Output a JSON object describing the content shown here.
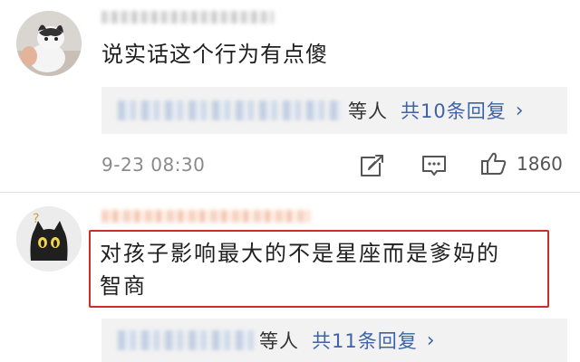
{
  "comments": [
    {
      "text": "说实话这个行为有点傻",
      "replies": {
        "others_label": "等人",
        "count_label": "共10条回复",
        "chevron": "›"
      },
      "time": "9-23 08:30",
      "likes": "1860",
      "avatar_icon": "cat-photo-avatar",
      "action_icons": [
        "share-icon",
        "comment-icon",
        "thumbs-up-icon"
      ]
    },
    {
      "text_line1": "对孩子影响最大的不是星座而是爹妈的",
      "text_line2": "智商",
      "replies": {
        "others_label": "等人",
        "count_label": "共11条回复",
        "chevron": "›"
      },
      "avatar_icon": "black-cat-question-avatar"
    }
  ],
  "colors": {
    "link_blue": "#3f63a6",
    "highlight_red": "#d12a2a",
    "reply_bg": "#f2f2f2",
    "meta_gray": "#8a8a8a"
  }
}
